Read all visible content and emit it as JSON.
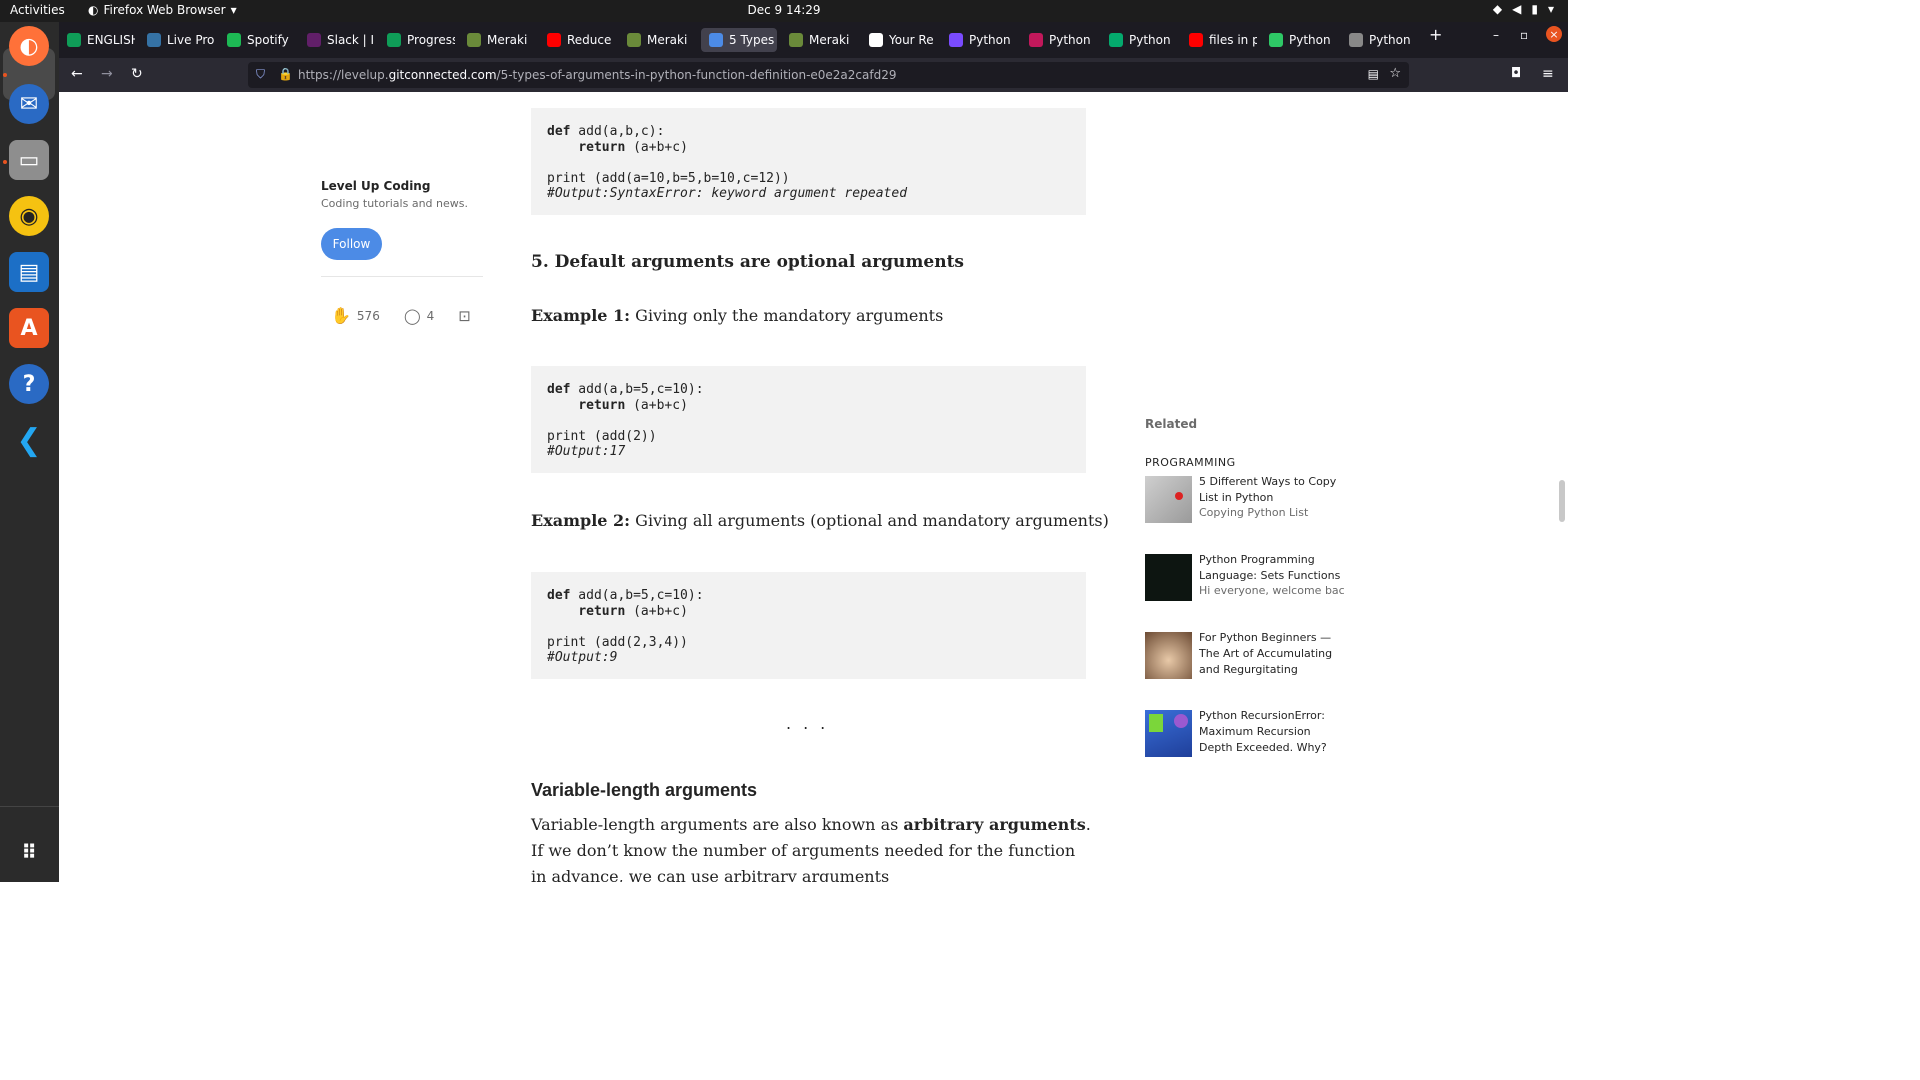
{
  "topbar": {
    "activities": "Activities",
    "app_menu": "Firefox Web Browser",
    "clock": "Dec 9  14:29"
  },
  "tabs": [
    {
      "label": "ENGLISH",
      "icon": "sheets-icon",
      "color": "#0f9d58"
    },
    {
      "label": "Live Pro",
      "icon": "python-icon",
      "color": "#3572a5"
    },
    {
      "label": "Spotify",
      "icon": "spotify-icon",
      "color": "#1db954"
    },
    {
      "label": "Slack | I",
      "icon": "slack-icon",
      "color": "#611f69"
    },
    {
      "label": "Progress",
      "icon": "sheets-icon",
      "color": "#0f9d58"
    },
    {
      "label": "Meraki",
      "icon": "meraki-icon",
      "color": "#6a8a3a"
    },
    {
      "label": "Reduce",
      "icon": "youtube-icon",
      "color": "#ff0000"
    },
    {
      "label": "Meraki",
      "icon": "meraki-icon",
      "color": "#6a8a3a"
    },
    {
      "label": "5 Types",
      "icon": "levelup-icon",
      "color": "#4c8be6",
      "active": true
    },
    {
      "label": "Meraki",
      "icon": "meraki-icon",
      "color": "#6a8a3a"
    },
    {
      "label": "Your Re",
      "icon": "github-icon",
      "color": "#ffffff"
    },
    {
      "label": "Python",
      "icon": "python-icon",
      "color": "#7a4bff"
    },
    {
      "label": "Python",
      "icon": "python-icon",
      "color": "#c2185b"
    },
    {
      "label": "Python",
      "icon": "w3-icon",
      "color": "#04aa6d"
    },
    {
      "label": "files in p",
      "icon": "youtube-icon",
      "color": "#ff0000"
    },
    {
      "label": "Python",
      "icon": "hackerrank-icon",
      "color": "#2ec866"
    },
    {
      "label": "Python",
      "icon": "page-icon",
      "color": "#888888"
    }
  ],
  "nav": {
    "url_prefix": "https://levelup.",
    "url_domain": "gitconnected.com",
    "url_path": "/5-types-of-arguments-in-python-function-definition-e0e2a2cafd29"
  },
  "publication": {
    "name": "Level Up Coding",
    "description": "Coding tutorials and news.",
    "follow_label": "Follow",
    "claps": "576",
    "comments": "4"
  },
  "article": {
    "code1": {
      "l1_kw": "def",
      "l1": " add(a,b,c):",
      "l2_kw": "return",
      "l2": " (a+b+c)",
      "l4": "print (add(a=10,b=5,b=10,c=12))",
      "l5": "#Output:SyntaxError: keyword argument repeated"
    },
    "heading5": "5. Default arguments are optional arguments",
    "ex1_label": "Example 1:",
    "ex1_text": " Giving only the mandatory arguments",
    "code2": {
      "l1_kw": "def",
      "l1": " add(a,b=5,c=10):",
      "l2_kw": "return",
      "l2": " (a+b+c)",
      "l4": "print (add(2))",
      "l5": "#Output:17"
    },
    "ex2_label": "Example 2:",
    "ex2_text": " Giving all arguments (optional and mandatory arguments)",
    "code3": {
      "l1_kw": "def",
      "l1": " add(a,b=5,c=10):",
      "l2_kw": "return",
      "l2": " (a+b+c)",
      "l4": "print (add(2,3,4))",
      "l5": "#Output:9"
    },
    "separator": "...",
    "var_heading": "Variable-length arguments",
    "var_p1": "Variable-length arguments are also known as ",
    "var_bold": "arbitrary arguments",
    "var_p2": ". If we don’t know the number of arguments needed for the function in advance, we can use arbitrary arguments"
  },
  "sidebar": {
    "related_label": "Related",
    "category": "PROGRAMMING",
    "items": [
      {
        "title": "5 Different Ways to Copy List in Python",
        "subtitle": "Copying Python List"
      },
      {
        "title": "Python Programming Language: Sets Functions",
        "subtitle": "Hi everyone, welcome back...."
      },
      {
        "title": "For Python Beginners — The Art of Accumulating and Regurgitating",
        "subtitle": ""
      },
      {
        "title": "Python RecursionError: Maximum Recursion Depth Exceeded. Why?",
        "subtitle": ""
      }
    ]
  }
}
